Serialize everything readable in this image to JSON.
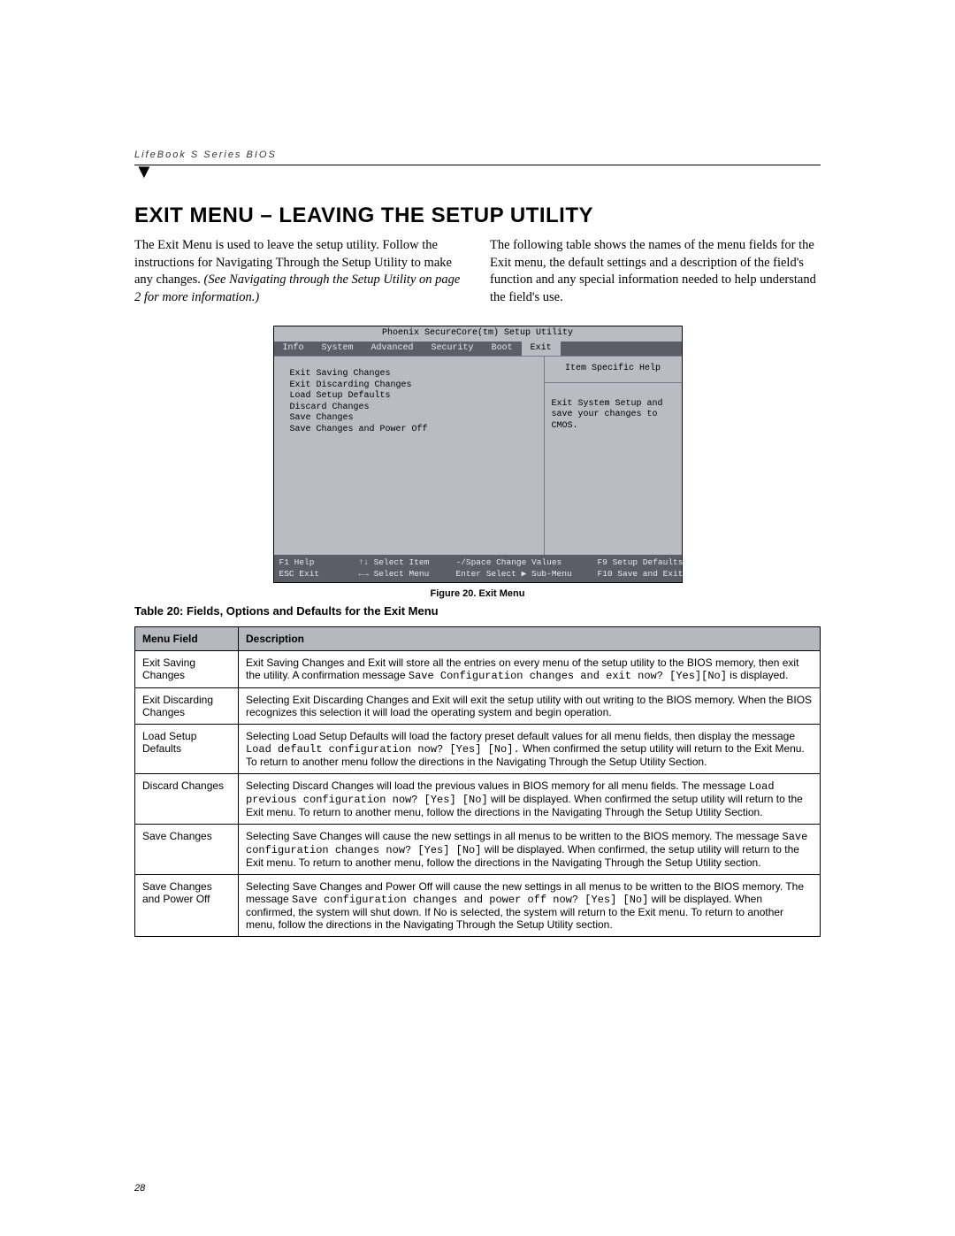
{
  "header": "LifeBook S Series BIOS",
  "title": "EXIT MENU – LEAVING THE SETUP UTILITY",
  "intro_left_1": "The Exit Menu is used to leave the setup utility. Follow the instructions for Navigating Through the Setup Utility to make any changes. ",
  "intro_left_em": "(See Navigating through the Setup Utility on page 2 for more information.)",
  "intro_right": "The following table shows the names of the menu fields for the Exit menu, the default settings and a description of the field's function and any special information needed to help understand the field's use.",
  "bios": {
    "title": "Phoenix SecureCore(tm) Setup Utility",
    "tabs": [
      "Info",
      "System",
      "Advanced",
      "Security",
      "Boot",
      "Exit"
    ],
    "active_tab": "Exit",
    "items": [
      "Exit Saving Changes",
      "Exit Discarding Changes",
      "Load Setup Defaults",
      "Discard Changes",
      "Save Changes",
      "Save Changes and Power Off"
    ],
    "help_title": "Item Specific Help",
    "help_body": "Exit System Setup and save your changes to CMOS.",
    "footer": {
      "row1": [
        "F1  Help",
        "↑↓ Select Item",
        "-/Space  Change Values",
        "F9   Setup Defaults"
      ],
      "row2": [
        "ESC Exit",
        "←→ Select Menu",
        "Enter   Select ▶ Sub-Menu",
        "F10  Save and Exit"
      ]
    }
  },
  "figure_caption": "Figure 20.  Exit Menu",
  "table_caption": "Table 20: Fields, Options and Defaults for the Exit Menu",
  "table": {
    "headers": [
      "Menu Field",
      "Description"
    ],
    "rows": [
      {
        "field": "Exit Saving Changes",
        "desc_pre": "Exit Saving Changes and Exit will store all the entries on every menu of the setup utility to the BIOS memory, then exit the utility. A confirmation message ",
        "desc_mono": "Save Configuration changes and exit now? [Yes][No]",
        "desc_post": " is displayed."
      },
      {
        "field": "Exit Discarding Changes",
        "desc_pre": "Selecting Exit Discarding Changes and Exit will exit the setup utility with out writing to the BIOS memory. When the BIOS recognizes this selection it will load the operating system and begin operation.",
        "desc_mono": "",
        "desc_post": ""
      },
      {
        "field": "Load Setup Defaults",
        "desc_pre": "Selecting Load Setup Defaults will load the factory preset default values for all menu fields, then display the message ",
        "desc_mono": "Load default configuration now? [Yes] [No].",
        "desc_post": " When confirmed the setup utility will return to the Exit Menu. To return to another menu follow the directions in the Navigating Through the Setup Utility Section."
      },
      {
        "field": "Discard Changes",
        "desc_pre": "Selecting Discard Changes will load the previous values in BIOS memory for all menu fields. The message ",
        "desc_mono": "Load previous configuration now? [Yes] [No]",
        "desc_post": " will be displayed. When confirmed the setup utility will return to the Exit menu. To return to another menu, follow the directions in the Navigating Through the Setup Utility Section."
      },
      {
        "field": "Save Changes",
        "desc_pre": "Selecting Save Changes will cause the new settings in all menus to be written to the BIOS memory. The message ",
        "desc_mono": "Save configuration changes now? [Yes] [No]",
        "desc_post": " will be displayed. When confirmed, the setup utility will return to the Exit menu. To return to another menu, follow the directions in the Navigating Through the Setup Utility section."
      },
      {
        "field": "Save Changes and Power Off",
        "desc_pre": "Selecting Save Changes and Power Off will cause the new settings in all menus to be written to the BIOS memory. The message ",
        "desc_mono": "Save configuration changes and power off now? [Yes] [No]",
        "desc_post": " will be displayed. When confirmed, the system will shut down. If No is selected, the system will return to the Exit menu. To return to another menu, follow the directions in the Navigating Through the Setup Utility section."
      }
    ]
  },
  "page_number": "28"
}
